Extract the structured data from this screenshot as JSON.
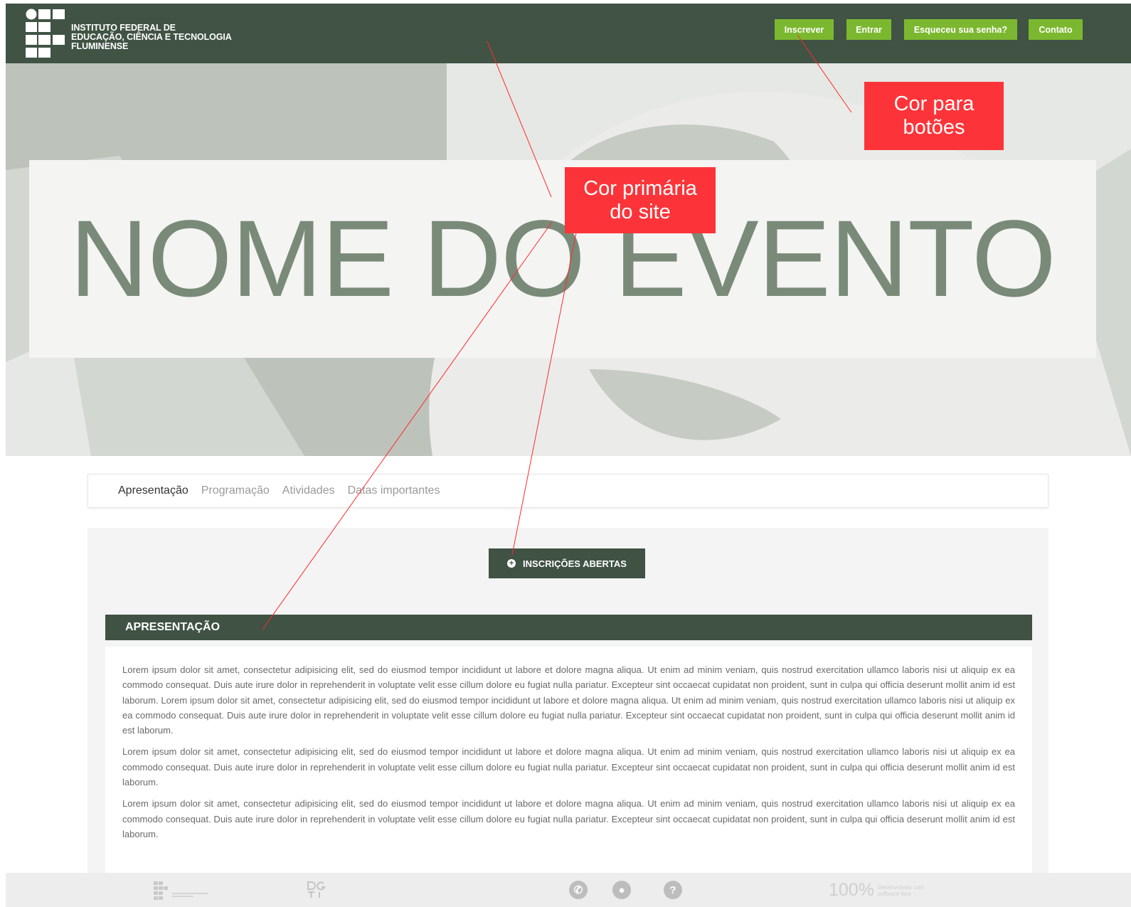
{
  "header": {
    "logo_line1": "INSTITUTO FEDERAL DE",
    "logo_line2": "EDUCAÇÃO, CIÊNCIA E TECNOLOGIA",
    "logo_line3": "FLUMINENSE",
    "buttons": [
      {
        "label": "Inscrever"
      },
      {
        "label": "Entrar"
      },
      {
        "label": "Esqueceu sua senha?"
      },
      {
        "label": "Contato"
      }
    ]
  },
  "hero": {
    "title": "NOME DO EVENTO"
  },
  "tabs": [
    {
      "label": "Apresentação",
      "active": true
    },
    {
      "label": "Programação",
      "active": false
    },
    {
      "label": "Atividades",
      "active": false
    },
    {
      "label": "Datas importantes",
      "active": false
    }
  ],
  "cta": {
    "icon": "plus-circle-icon",
    "label": "INSCRIÇÕES ABERTAS"
  },
  "section": {
    "title": "APRESENTAÇÃO",
    "paragraphs": [
      "Lorem ipsum dolor sit amet, consectetur adipisicing elit, sed do eiusmod tempor incididunt ut labore et dolore magna aliqua. Ut enim ad minim veniam, quis nostrud exercitation ullamco laboris nisi ut aliquip ex ea commodo consequat. Duis aute irure dolor in reprehenderit in voluptate velit esse cillum dolore eu fugiat nulla pariatur. Excepteur sint occaecat cupidatat non proident, sunt in culpa qui officia deserunt mollit anim id est laborum. Lorem ipsum dolor sit amet, consectetur adipisicing elit, sed do eiusmod tempor incididunt ut labore et dolore magna aliqua. Ut enim ad minim veniam, quis nostrud exercitation ullamco laboris nisi ut aliquip ex ea commodo consequat. Duis aute irure dolor in reprehenderit in voluptate velit esse cillum dolore eu fugiat nulla pariatur. Excepteur sint occaecat cupidatat non proident, sunt in culpa qui officia deserunt mollit anim id est laborum.",
      "Lorem ipsum dolor sit amet, consectetur adipisicing elit, sed do eiusmod tempor incididunt ut labore et dolore magna aliqua. Ut enim ad minim veniam, quis nostrud exercitation ullamco laboris nisi ut aliquip ex ea commodo consequat. Duis aute irure dolor in reprehenderit in voluptate velit esse cillum dolore eu fugiat nulla pariatur. Excepteur sint occaecat cupidatat non proident, sunt in culpa qui officia deserunt mollit anim id est laborum.",
      "Lorem ipsum dolor sit amet, consectetur adipisicing elit, sed do eiusmod tempor incididunt ut labore et dolore magna aliqua. Ut enim ad minim veniam, quis nostrud exercitation ullamco laboris nisi ut aliquip ex ea commodo consequat. Duis aute irure dolor in reprehenderit in voluptate velit esse cillum dolore eu fugiat nulla pariatur. Excepteur sint occaecat cupidatat non proident, sunt in culpa qui officia deserunt mollit anim id est laborum."
    ]
  },
  "footer": {
    "icons": [
      "ifluminense-logo-icon",
      "dgti-logo-icon",
      "phone-icon",
      "map-pin-icon",
      "help-icon"
    ],
    "software_livre_big": "100%",
    "software_livre_line1": "Desenvolvido com",
    "software_livre_line2": "software livre"
  },
  "annotations": {
    "buttons_color": "Cor para botões",
    "primary_color": "Cor primária do site"
  },
  "colors": {
    "primary": "#405344",
    "buttons": "#7cb82f",
    "annotation": "#fc3439",
    "hero_title": "#7a8a78"
  }
}
